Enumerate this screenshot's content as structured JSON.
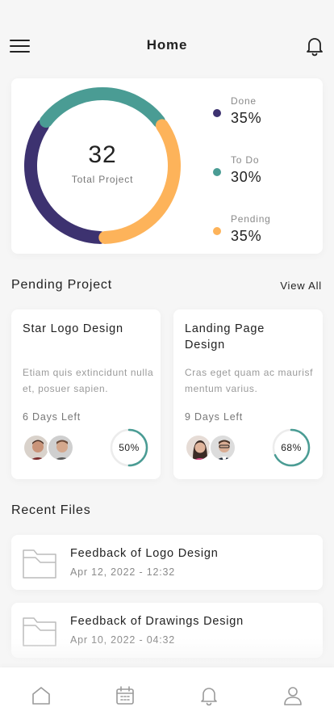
{
  "header": {
    "title": "Home",
    "menu_icon": "hamburger-menu-icon",
    "notification_icon": "bell-icon"
  },
  "summary": {
    "total": "32",
    "total_label": "Total Project",
    "segments": [
      {
        "name": "Done",
        "value": "35%",
        "fraction": 0.35,
        "color": "#3d3270"
      },
      {
        "name": "To Do",
        "value": "30%",
        "fraction": 0.3,
        "color": "#4a9c94"
      },
      {
        "name": "Pending",
        "value": "35%",
        "fraction": 0.35,
        "color": "#fdb35a"
      }
    ]
  },
  "pending_section": {
    "title": "Pending Project",
    "view_all": "View All"
  },
  "projects": [
    {
      "title": "Star Logo Design",
      "description": "Etiam quis extincidunt nulla et, posuer sapien.",
      "days_left": "6 Days Left",
      "progress_label": "50%",
      "progress": 0.5
    },
    {
      "title": "Landing Page Design",
      "description": "Cras eget quam ac maurisf mentum varius.",
      "days_left": "9 Days Left",
      "progress_label": "68%",
      "progress": 0.68
    }
  ],
  "recent_section": {
    "title": "Recent Files"
  },
  "files": [
    {
      "name": "Feedback of Logo Design",
      "date": "Apr 12, 2022 - 12:32",
      "icon": "folder-icon"
    },
    {
      "name": "Feedback of Drawings Design",
      "date": "Apr 10, 2022 - 04:32",
      "icon": "folder-icon"
    }
  ],
  "tabbar": {
    "items": [
      "home-icon",
      "calendar-icon",
      "bell-icon",
      "user-icon"
    ]
  },
  "colors": {
    "accent": "#4a9c94",
    "done": "#3d3270",
    "pending": "#fdb35a",
    "background": "#f6f6f6"
  }
}
